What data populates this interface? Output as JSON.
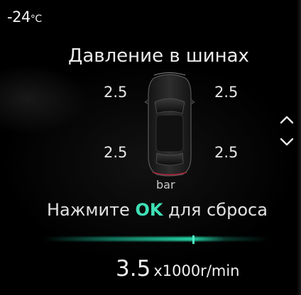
{
  "status": {
    "temperature": "-24",
    "temperature_unit": "°C"
  },
  "tire_pressure": {
    "title": "Давление в шинах",
    "front_left": "2.5",
    "front_right": "2.5",
    "rear_left": "2.5",
    "rear_right": "2.5",
    "unit": "bar"
  },
  "hint": {
    "prefix": "Нажмите",
    "key": "OK",
    "suffix": "для сброса"
  },
  "rpm": {
    "value": "3.5",
    "unit": "x1000r/min",
    "level_fraction": 0.66
  },
  "icons": {
    "scroll_up": "chevron-up-icon",
    "scroll_down": "chevron-down-icon",
    "vehicle": "car-top-view-icon"
  },
  "colors": {
    "accent": "#3fe0b6",
    "background": "#000000",
    "text": "#e8e8e8"
  }
}
